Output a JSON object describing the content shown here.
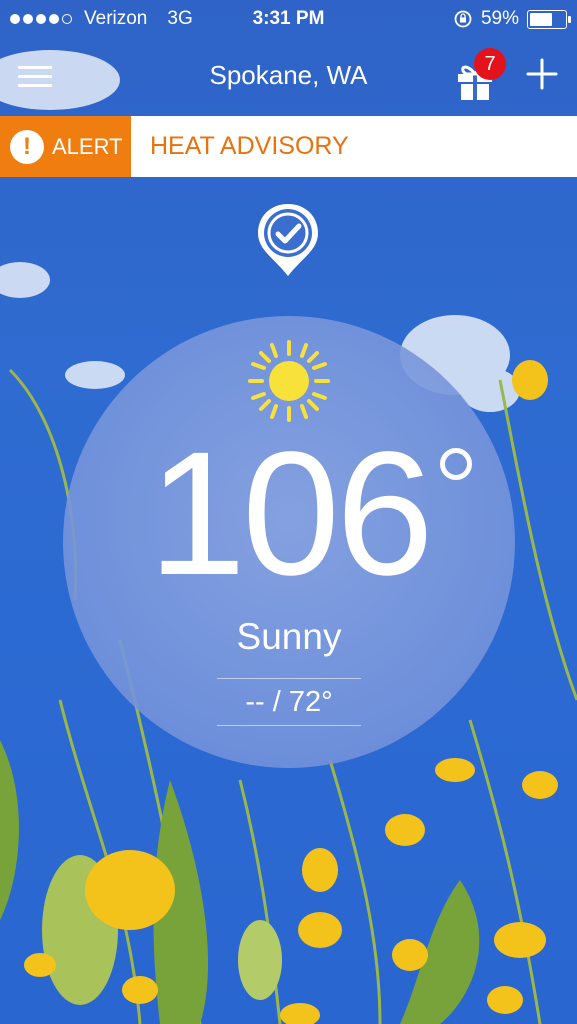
{
  "status_bar": {
    "carrier": "Verizon",
    "network": "3G",
    "time": "3:31 PM",
    "battery": "59%",
    "battery_level": 0.59
  },
  "nav": {
    "city": "Spokane, WA",
    "gift_badge": "7",
    "icons": [
      "menu-icon",
      "gift-icon",
      "plus-icon"
    ]
  },
  "alert": {
    "label": "ALERT",
    "text": "HEAT ADVISORY",
    "color": "#f07d10"
  },
  "weather": {
    "temperature": "106",
    "condition": "Sunny",
    "hi_lo": "-- / 72°",
    "icon": "sun-icon",
    "sun_color": "#f8e23a"
  }
}
